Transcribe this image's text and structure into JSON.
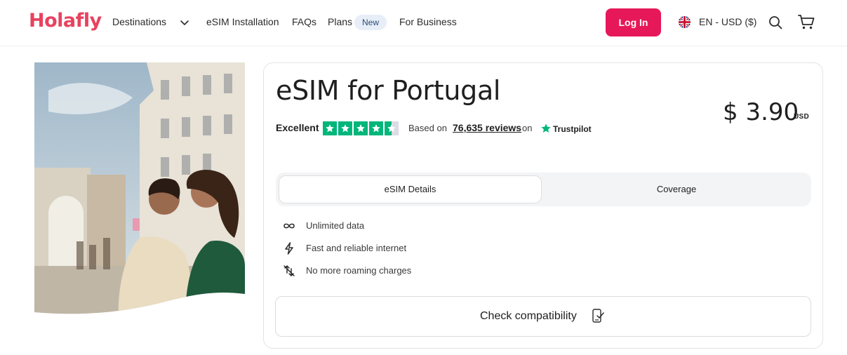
{
  "header": {
    "logo": "Holafly",
    "nav": {
      "destinations": "Destinations",
      "esim_installation": "eSIM Installation",
      "faqs": "FAQs",
      "plans": "Plans",
      "plans_badge": "New",
      "for_business": "For Business"
    },
    "login_label": "Log In",
    "language_currency": "EN - USD ($)",
    "icons": [
      "chevron-down-icon",
      "uk-flag-icon",
      "search-icon",
      "cart-icon"
    ]
  },
  "product": {
    "title": "eSIM for Portugal",
    "price": "$ 3.90",
    "currency": "USD",
    "rating": {
      "label": "Excellent",
      "stars": 4.5,
      "based_on": "Based on",
      "reviews": "76,635 reviews",
      "on": "on",
      "provider": "Trustpilot"
    },
    "tabs": [
      {
        "label": "eSIM Details",
        "active": true
      },
      {
        "label": "Coverage",
        "active": false
      }
    ],
    "features": [
      {
        "icon": "infinity-icon",
        "label": "Unlimited data"
      },
      {
        "icon": "lightning-icon",
        "label": "Fast and reliable internet"
      },
      {
        "icon": "no-roaming-icon",
        "label": "No more roaming charges"
      }
    ],
    "check_label": "Check compatibility"
  },
  "colors": {
    "brand": "#e8425f",
    "login_bg": "#e6185a",
    "trustpilot_green": "#00b67a",
    "badge_bg": "#e7eef8"
  }
}
